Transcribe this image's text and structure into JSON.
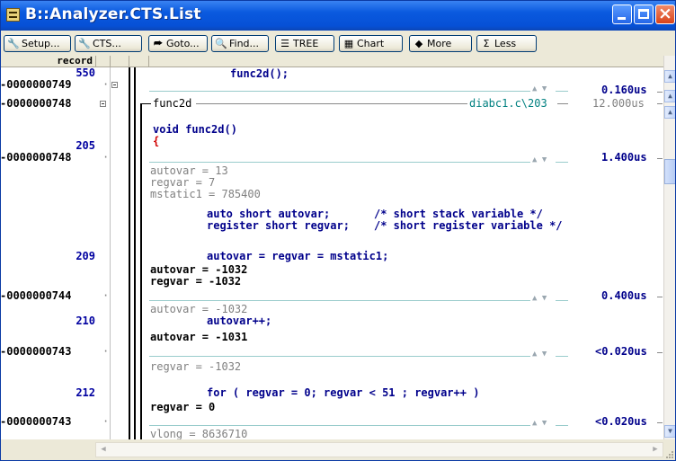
{
  "window": {
    "title": "B::Analyzer.CTS.List",
    "controls": {
      "minimize": "minimize",
      "maximize": "maximize",
      "close": "×"
    }
  },
  "toolbar": [
    {
      "label": "Setup...",
      "icon": "wrench-icon",
      "glyph": "🔧"
    },
    {
      "label": "CTS...",
      "icon": "wrench-icon",
      "glyph": "🔧"
    },
    {
      "label": "Goto...",
      "icon": "goto-icon",
      "glyph": "⮫"
    },
    {
      "label": "Find...",
      "icon": "find-icon",
      "glyph": "🔍"
    },
    {
      "label": "TREE",
      "icon": "tree-icon",
      "glyph": "☰"
    },
    {
      "label": "Chart",
      "icon": "chart-icon",
      "glyph": "▦"
    },
    {
      "label": "More",
      "icon": "updown-icon",
      "glyph": "◆"
    },
    {
      "label": "Less",
      "icon": "sigma-icon",
      "glyph": "Σ"
    }
  ],
  "header": {
    "record": "record"
  },
  "rows": {
    "r1": {
      "record": "550",
      "code": "func2d();"
    },
    "r2": {
      "record": "-0000000749",
      "time": "0.160us"
    },
    "r3": {
      "record": "-0000000748",
      "label": "func2d",
      "source": "diabc1.c\\203",
      "time": "12.000us"
    },
    "r4": {
      "code": "void func2d()"
    },
    "r5": {
      "record": "205",
      "code": "{"
    },
    "r6": {
      "record": "-0000000748",
      "time": "1.400us"
    },
    "r7": {
      "text": "autovar = 13"
    },
    "r8": {
      "text": "regvar = 7"
    },
    "r9": {
      "text": "mstatic1 = 785400"
    },
    "r10": {
      "code": "auto short autovar;",
      "comment": "/* short stack variable */"
    },
    "r11": {
      "code": "register short regvar;",
      "comment": "/* short register variable */"
    },
    "r12": {
      "record": "209",
      "code": "autovar = regvar = mstatic1;"
    },
    "r13": {
      "text": "autovar = -1032"
    },
    "r14": {
      "text": "regvar = -1032"
    },
    "r15": {
      "record": "-0000000744",
      "time": "0.400us"
    },
    "r16": {
      "text": "autovar = -1032"
    },
    "r17": {
      "record": "210",
      "code": "autovar++;"
    },
    "r18": {
      "text": "autovar = -1031"
    },
    "r19": {
      "record": "-0000000743",
      "time": "<0.020us"
    },
    "r20": {
      "text": "regvar = -1032"
    },
    "r21": {
      "record": "212",
      "code": "for ( regvar = 0; regvar < 51 ; regvar++ )"
    },
    "r22": {
      "text": "regvar = 0"
    },
    "r23": {
      "record": "-0000000743",
      "time": "<0.020us"
    },
    "r24": {
      "text": "vlong = 8636710"
    }
  },
  "colors": {
    "title_bar": "#0650d6",
    "code": "#00008b",
    "source_ref": "#008080",
    "gray_text": "#808080"
  }
}
